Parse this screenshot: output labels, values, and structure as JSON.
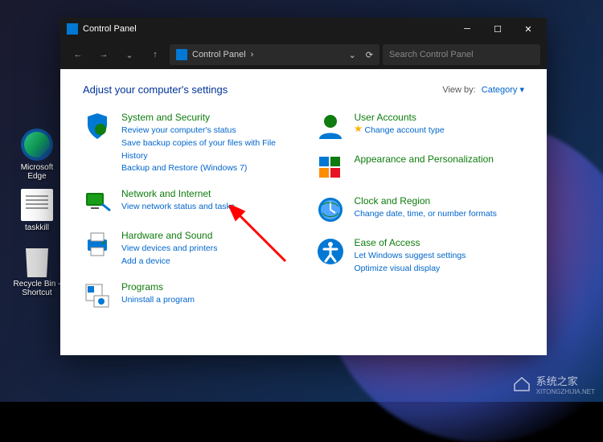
{
  "desktop": {
    "icons": [
      {
        "label": "Microsoft Edge"
      },
      {
        "label": "taskkill"
      },
      {
        "label": "Recycle Bin - Shortcut"
      }
    ]
  },
  "window": {
    "title": "Control Panel",
    "breadcrumb": "Control Panel",
    "search_placeholder": "Search Control Panel",
    "heading": "Adjust your computer's settings",
    "view_by_label": "View by:",
    "view_by_value": "Category"
  },
  "categories_left": [
    {
      "title": "System and Security",
      "links": [
        "Review your computer's status",
        "Save backup copies of your files with File History",
        "Backup and Restore (Windows 7)"
      ]
    },
    {
      "title": "Network and Internet",
      "links": [
        "View network status and tasks"
      ]
    },
    {
      "title": "Hardware and Sound",
      "links": [
        "View devices and printers",
        "Add a device"
      ]
    },
    {
      "title": "Programs",
      "links": [
        "Uninstall a program"
      ]
    }
  ],
  "categories_right": [
    {
      "title": "User Accounts",
      "links": [
        "Change account type"
      ],
      "badge": true
    },
    {
      "title": "Appearance and Personalization",
      "links": []
    },
    {
      "title": "Clock and Region",
      "links": [
        "Change date, time, or number formats"
      ]
    },
    {
      "title": "Ease of Access",
      "links": [
        "Let Windows suggest settings",
        "Optimize visual display"
      ]
    }
  ],
  "watermark": {
    "text": "系统之家",
    "url": "XITONGZHIJIA.NET"
  }
}
